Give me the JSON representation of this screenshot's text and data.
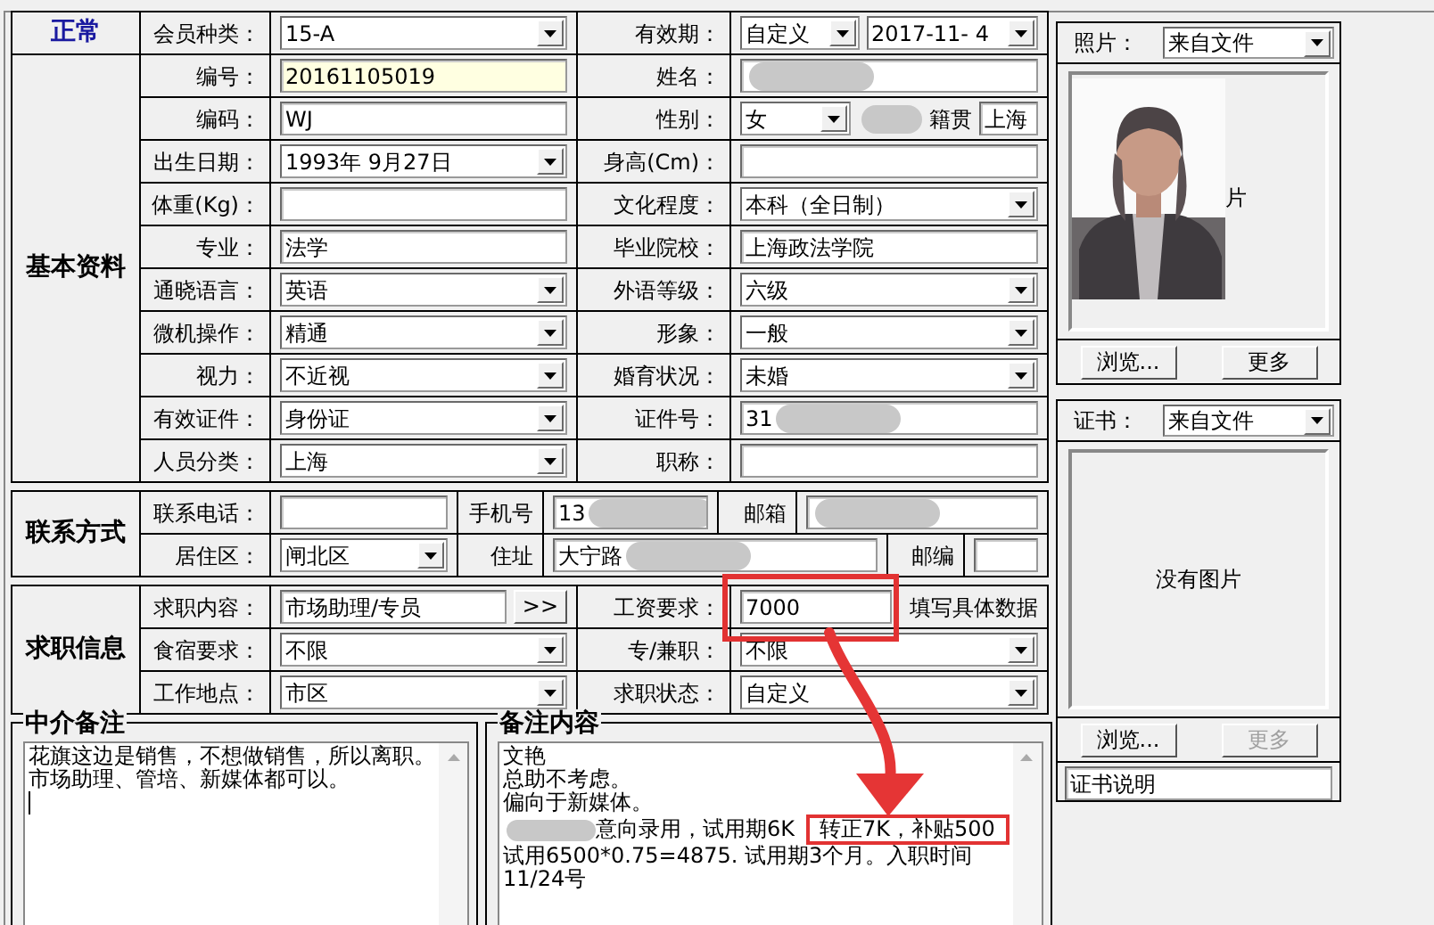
{
  "sections": [
    {
      "kind": "status",
      "title": "正常",
      "rows": [
        [
          {
            "label": "会员种类：",
            "control": {
              "kind": "combo",
              "value": "15-A"
            }
          },
          {
            "label": "有效期：",
            "control": {
              "kind": "group",
              "parts": [
                {
                  "kind": "combo",
                  "value": "自定义"
                },
                {
                  "kind": "combo",
                  "value": "2017-11- 4"
                }
              ]
            }
          }
        ]
      ]
    },
    {
      "kind": "form",
      "title": "基本资料",
      "rows": [
        [
          {
            "label": "编号：",
            "control": {
              "kind": "text",
              "value": "20161105019",
              "highlighted": true
            }
          },
          {
            "label": "姓名：",
            "control": {
              "kind": "text",
              "redacted": true
            }
          }
        ],
        [
          {
            "label": "编码：",
            "control": {
              "kind": "text",
              "value": "WJ"
            }
          },
          {
            "label": "性别：",
            "control": {
              "kind": "group",
              "parts": [
                {
                  "kind": "combo",
                  "value": "女"
                },
                {
                  "kind": "redaction"
                },
                {
                  "kind": "label",
                  "value": "籍贯"
                },
                {
                  "kind": "text",
                  "value": "上海"
                }
              ]
            }
          }
        ],
        [
          {
            "label": "出生日期：",
            "control": {
              "kind": "combo",
              "value": "1993年 9月27日"
            }
          },
          {
            "label": "身高(Cm)：",
            "control": {
              "kind": "text"
            }
          }
        ],
        [
          {
            "label": "体重(Kg)：",
            "control": {
              "kind": "text"
            }
          },
          {
            "label": "文化程度：",
            "control": {
              "kind": "combo",
              "value": "本科（全日制）"
            }
          }
        ],
        [
          {
            "label": "专业：",
            "control": {
              "kind": "text",
              "value": "法学"
            }
          },
          {
            "label": "毕业院校：",
            "control": {
              "kind": "text",
              "value": "上海政法学院"
            }
          }
        ],
        [
          {
            "label": "通晓语言：",
            "control": {
              "kind": "combo",
              "value": "英语"
            }
          },
          {
            "label": "外语等级：",
            "control": {
              "kind": "combo",
              "value": "六级"
            }
          }
        ],
        [
          {
            "label": "微机操作：",
            "control": {
              "kind": "combo",
              "value": "精通"
            }
          },
          {
            "label": "形象：",
            "control": {
              "kind": "combo",
              "value": "一般"
            }
          }
        ],
        [
          {
            "label": "视力：",
            "control": {
              "kind": "combo",
              "value": "不近视"
            }
          },
          {
            "label": "婚育状况：",
            "control": {
              "kind": "combo",
              "value": "未婚"
            }
          }
        ],
        [
          {
            "label": "有效证件：",
            "control": {
              "kind": "combo",
              "value": "身份证"
            }
          },
          {
            "label": "证件号：",
            "control": {
              "kind": "text",
              "value": "31",
              "redacted": true
            }
          }
        ],
        [
          {
            "label": "人员分类：",
            "control": {
              "kind": "combo",
              "value": "上海"
            }
          },
          {
            "label": "职称：",
            "control": {
              "kind": "text"
            }
          }
        ]
      ]
    },
    {
      "kind": "contact",
      "title": "联系方式",
      "rows": [
        [
          {
            "label": "联系电话：",
            "control": {
              "kind": "text"
            }
          },
          {
            "label": "手机号",
            "control": {
              "kind": "text",
              "value": "13",
              "redacted": true
            }
          },
          {
            "label": "邮箱",
            "control": {
              "kind": "text",
              "redacted": true
            }
          }
        ],
        [
          {
            "label": "居住区：",
            "control": {
              "kind": "combo",
              "value": "闸北区"
            }
          },
          {
            "label": "住址",
            "control": {
              "kind": "text",
              "value": "大宁路",
              "redacted": true
            }
          },
          {
            "label": "邮编",
            "control": {
              "kind": "text"
            }
          }
        ]
      ]
    },
    {
      "kind": "form",
      "title": "求职信息",
      "rows": [
        [
          {
            "label": "求职内容：",
            "control": {
              "kind": "group",
              "parts": [
                {
                  "kind": "text",
                  "value": "市场助理/专员"
                },
                {
                  "kind": "button",
                  "value": ">>"
                }
              ]
            }
          },
          {
            "label": "工资要求：",
            "control": {
              "kind": "group",
              "parts": [
                {
                  "kind": "text",
                  "value": "7000",
                  "boxed": true
                },
                {
                  "kind": "label",
                  "value": "填写具体数据"
                }
              ]
            }
          }
        ],
        [
          {
            "label": "食宿要求：",
            "control": {
              "kind": "combo",
              "value": "不限"
            }
          },
          {
            "label": "专/兼职：",
            "control": {
              "kind": "combo",
              "value": "不限"
            }
          }
        ],
        [
          {
            "label": "工作地点：",
            "control": {
              "kind": "combo",
              "value": "市区"
            }
          },
          {
            "label": "求职状态：",
            "control": {
              "kind": "combo",
              "value": "自定义"
            }
          }
        ]
      ]
    }
  ],
  "notes": [
    {
      "title": "中介备注",
      "cursor": true,
      "lines": [
        [
          {
            "text": "花旗这边是销售，不想做销售，所以离职。"
          }
        ],
        [
          {
            "text": "市场助理、管培、新媒体都可以。"
          }
        ]
      ]
    },
    {
      "title": "备注内容",
      "cursor": false,
      "lines": [
        [
          {
            "text": "文艳"
          }
        ],
        [
          {
            "text": "总助不考虑。"
          }
        ],
        [
          {
            "text": "偏向于新媒体。"
          }
        ],
        [
          {
            "kind": "redaction"
          },
          {
            "text": "意向录用，试用期6K"
          },
          {
            "text": "转正7K，补贴500",
            "boxed": true
          }
        ],
        [
          {
            "text": "试用6500*0.75=4875. 试用期3个月。入职时间"
          }
        ],
        [
          {
            "text": "11/24号"
          }
        ]
      ]
    }
  ],
  "annotation_arrow": true,
  "photo": {
    "label": "照片：",
    "source": "来自文件",
    "kind": "picture",
    "caption": "片",
    "buttons": [
      {
        "label": "浏览...",
        "disabled": false
      },
      {
        "label": "更多",
        "disabled": false
      }
    ]
  },
  "certificate": {
    "label": "证书：",
    "source": "来自文件",
    "empty_text": "没有图片",
    "buttons": [
      {
        "label": "浏览...",
        "disabled": false
      },
      {
        "label": "更多",
        "disabled": true
      }
    ],
    "description": "证书说明"
  }
}
